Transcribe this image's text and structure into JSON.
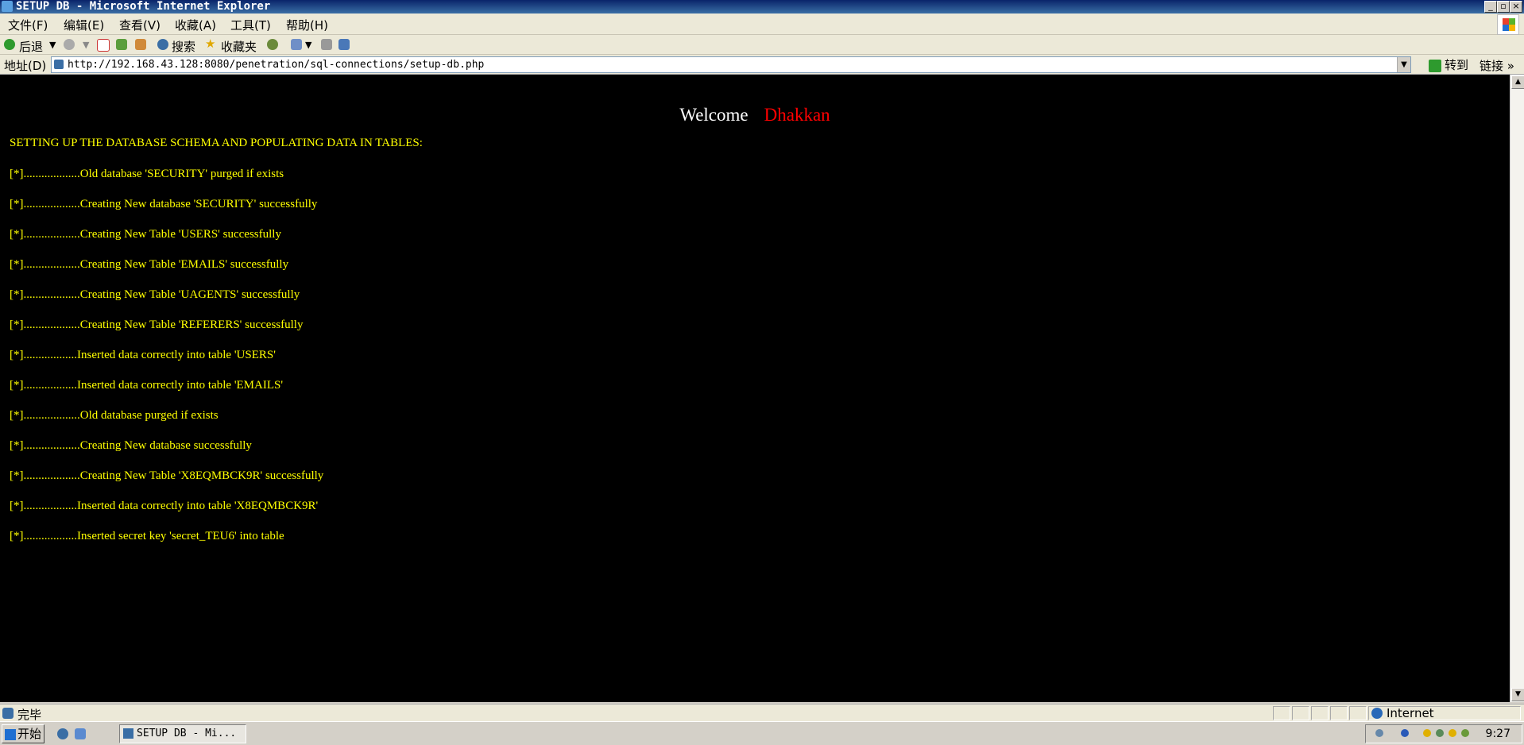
{
  "window": {
    "title": "SETUP DB - Microsoft Internet Explorer"
  },
  "menu": {
    "items": [
      "文件(F)",
      "编辑(E)",
      "查看(V)",
      "收藏(A)",
      "工具(T)",
      "帮助(H)"
    ]
  },
  "toolbar": {
    "back_label": "后退",
    "search_label": "搜索",
    "favorites_label": "收藏夹"
  },
  "address": {
    "label": "地址(D)",
    "url": "http://192.168.43.128:8080/penetration/sql-connections/setup-db.php",
    "go_label": "转到",
    "links_label": "链接"
  },
  "page": {
    "welcome": "Welcome",
    "name": "Dhakkan",
    "heading": "SETTING UP THE DATABASE SCHEMA AND POPULATING DATA IN TABLES:",
    "lines": [
      "[*]...................Old database 'SECURITY' purged if exists",
      "[*]...................Creating New database 'SECURITY' successfully",
      "[*]...................Creating New Table 'USERS' successfully",
      "[*]...................Creating New Table 'EMAILS' successfully",
      "[*]...................Creating New Table 'UAGENTS' successfully",
      "[*]...................Creating New Table 'REFERERS' successfully",
      "[*]..................Inserted data correctly into table 'USERS'",
      "[*]..................Inserted data correctly into table 'EMAILS'",
      "[*]...................Old database purged if exists",
      "[*]...................Creating New database successfully",
      "[*]...................Creating New Table 'X8EQMBCK9R' successfully",
      "[*]..................Inserted data correctly into table 'X8EQMBCK9R'",
      "[*]..................Inserted secret key 'secret_TEU6' into table"
    ]
  },
  "status": {
    "text": "完毕",
    "zone": "Internet"
  },
  "taskbar": {
    "start_label": "开始",
    "task_label": "SETUP DB - Mi...",
    "clock": "9:27"
  },
  "colors": {
    "page_bg": "#000000",
    "text_yellow": "#ffff00",
    "name_red": "#ff0000",
    "title_blue": "#0a246a"
  }
}
